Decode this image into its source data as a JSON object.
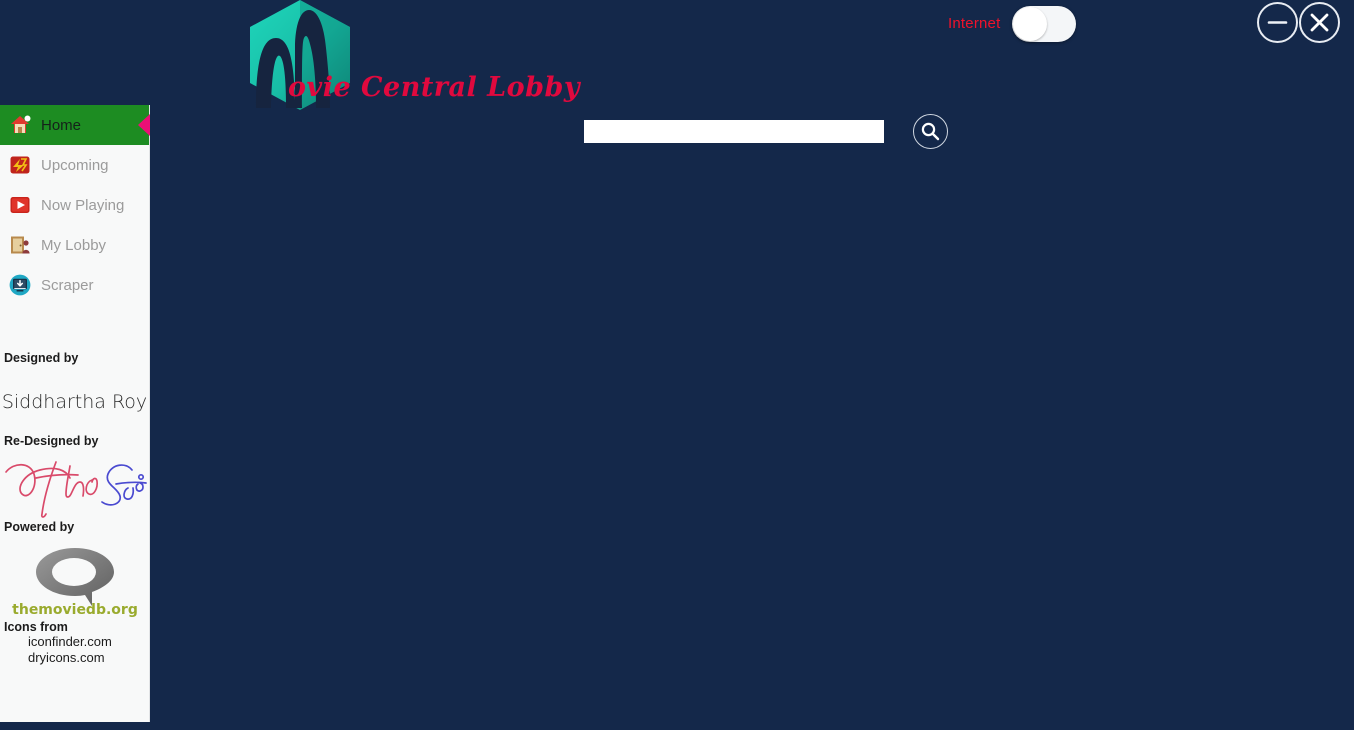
{
  "window": {
    "background_color": "#14284a",
    "minimize_label": "Minimize",
    "close_label": "Close"
  },
  "header": {
    "logo_icon": "hexagon-m-logo",
    "wordmark": "ovie Central Lobby",
    "wordmark_color": "#e0093e",
    "logo_hex_color": "#17b9a3",
    "internet": {
      "label": "Internet",
      "label_color": "#f0122b",
      "state": "off",
      "icon": "toggle-switch"
    }
  },
  "search": {
    "value": "",
    "placeholder": "",
    "button_icon": "search-icon"
  },
  "sidebar": {
    "background_color": "#f8f9f9",
    "active_index": 0,
    "active_color": "#1d8c22",
    "pointer_color": "#ec0f76",
    "items": [
      {
        "label": "Home",
        "icon": "house-icon",
        "active": true
      },
      {
        "label": "Upcoming",
        "icon": "clapperboard-icon",
        "active": false
      },
      {
        "label": "Now Playing",
        "icon": "play-button-icon",
        "active": false
      },
      {
        "label": "My Lobby",
        "icon": "door-person-icon",
        "active": false
      },
      {
        "label": "Scraper",
        "icon": "monitor-download-icon",
        "active": false
      }
    ],
    "credits": {
      "designed_by_label": "Designed by",
      "designer_name": "Siddhartha Roy",
      "redesigned_by_label": "Re-Designed by",
      "signature_first": "Partha",
      "signature_second": "Sai",
      "signature_first_color": "#d94a6a",
      "signature_second_color": "#4a4ad0",
      "powered_by_label": "Powered by",
      "tmdb_caption": "themoviedb.org",
      "tmdb_caption_color": "#9aab2e",
      "icons_from_label": "Icons from",
      "icon_sources": [
        "iconfinder.com",
        "dryicons.com"
      ]
    }
  }
}
